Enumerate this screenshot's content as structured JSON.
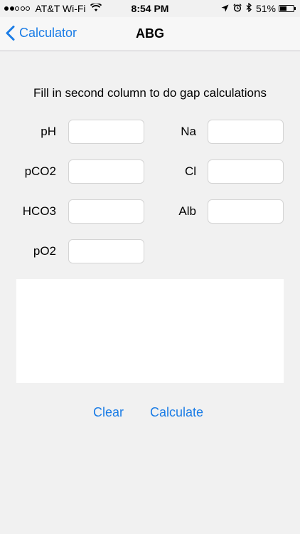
{
  "status_bar": {
    "carrier": "AT&T Wi-Fi",
    "time": "8:54 PM",
    "battery": "51%",
    "battery_level": 0.51,
    "signal_bars_filled": 2,
    "signal_bars_total": 5
  },
  "nav": {
    "back_label": "Calculator",
    "title": "ABG"
  },
  "instructions": "Fill in second column to do gap calculations",
  "fields": {
    "ph": {
      "label": "pH",
      "value": ""
    },
    "pco2": {
      "label": "pCO2",
      "value": ""
    },
    "hco3": {
      "label": "HCO3",
      "value": ""
    },
    "po2": {
      "label": "pO2",
      "value": ""
    },
    "na": {
      "label": "Na",
      "value": ""
    },
    "cl": {
      "label": "Cl",
      "value": ""
    },
    "alb": {
      "label": "Alb",
      "value": ""
    }
  },
  "result": "",
  "buttons": {
    "clear": "Clear",
    "calculate": "Calculate"
  },
  "colors": {
    "accent": "#1a7ce6",
    "background": "#f1f1f1"
  }
}
